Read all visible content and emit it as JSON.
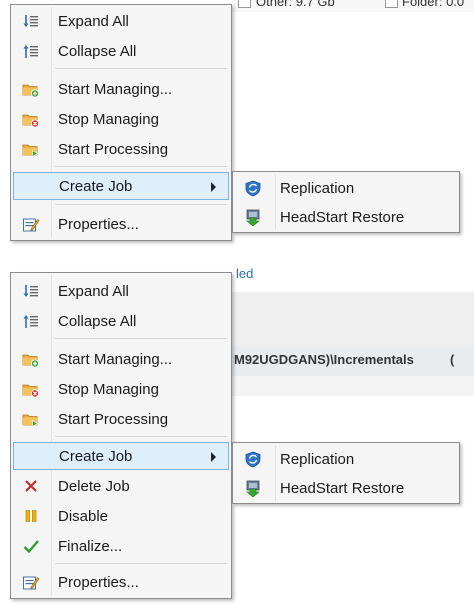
{
  "background": {
    "top_fragment_1": "Other: 9.7 Gb",
    "top_fragment_2": "Folder: 0.0",
    "bottom_fragment_1": "led",
    "bottom_fragment_2": "M92UGDGANS)\\Incrementals",
    "bottom_fragment_3": "("
  },
  "menu1": {
    "expand_all": "Expand All",
    "collapse_all": "Collapse All",
    "start_managing": "Start Managing...",
    "stop_managing": "Stop Managing",
    "start_processing": "Start Processing",
    "create_job": "Create Job",
    "properties": "Properties..."
  },
  "submenu1": {
    "replication": "Replication",
    "headstart_restore": "HeadStart Restore"
  },
  "menu2": {
    "expand_all": "Expand All",
    "collapse_all": "Collapse All",
    "start_managing": "Start Managing...",
    "stop_managing": "Stop Managing",
    "start_processing": "Start Processing",
    "create_job": "Create Job",
    "delete_job": "Delete Job",
    "disable": "Disable",
    "finalize": "Finalize...",
    "properties": "Properties..."
  },
  "submenu2": {
    "replication": "Replication",
    "headstart_restore": "HeadStart Restore"
  }
}
